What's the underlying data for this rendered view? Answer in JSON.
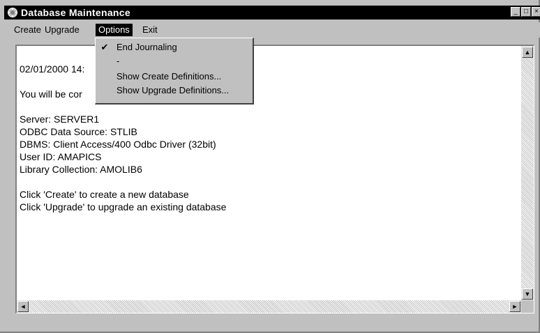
{
  "window": {
    "title": "Database Maintenance",
    "minimize_glyph": "_",
    "maximize_glyph": "□",
    "close_glyph": "×"
  },
  "menubar": {
    "items": [
      "Create",
      "Upgrade",
      "Options",
      "Exit"
    ],
    "active": "Options"
  },
  "options_menu": {
    "items": [
      {
        "label": "End Journaling",
        "checked": true,
        "check_glyph": "✔"
      },
      {
        "label": "-",
        "checked": false
      },
      {
        "label": "Show Create Definitions...",
        "checked": false
      },
      {
        "label": "Show Upgrade Definitions...",
        "checked": false
      }
    ]
  },
  "log": {
    "lines": [
      "02/01/2000 14:",
      "",
      "You will be cor",
      "",
      "Server: SERVER1",
      "ODBC Data Source: STLIB",
      "DBMS: Client Access/400 Odbc Driver (32bit)",
      "User ID: AMAPICS",
      "Library Collection: AMOLIB6",
      "",
      "Click 'Create' to create a new database",
      "Click 'Upgrade' to upgrade an existing database"
    ]
  },
  "scroll": {
    "up": "▲",
    "down": "▼",
    "left": "◄",
    "right": "►"
  }
}
